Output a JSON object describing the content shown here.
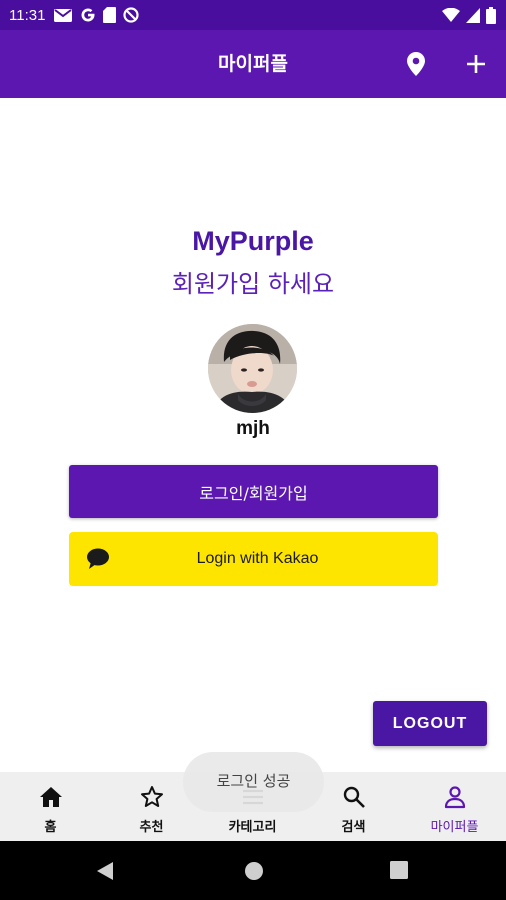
{
  "status_bar": {
    "time": "11:31",
    "icons_left": [
      "gmail-icon",
      "google-icon",
      "sd-card-icon",
      "do-not-disturb-icon"
    ],
    "icons_right": [
      "wifi-icon",
      "signal-icon",
      "battery-icon"
    ]
  },
  "app_bar": {
    "title": "마이퍼플",
    "actions": [
      "location-icon",
      "add-icon"
    ]
  },
  "profile": {
    "brand": "MyPurple",
    "subtitle": "회원가입 하세요",
    "username": "mjh"
  },
  "buttons": {
    "login_signup": "로그인/회원가입",
    "kakao_login": "Login with Kakao",
    "logout": "LOGOUT"
  },
  "toast": "로그인 성공",
  "bottom_nav": {
    "items": [
      {
        "label": "홈",
        "icon": "home-icon"
      },
      {
        "label": "추천",
        "icon": "star-icon"
      },
      {
        "label": "카테고리",
        "icon": "menu-icon"
      },
      {
        "label": "검색",
        "icon": "search-icon"
      },
      {
        "label": "마이퍼플",
        "icon": "person-icon",
        "active": true
      }
    ]
  },
  "colors": {
    "status_bar": "#4a0e9e",
    "primary": "#5b17b0",
    "kakao_yellow": "#fee500",
    "nav_background": "#efefef"
  }
}
